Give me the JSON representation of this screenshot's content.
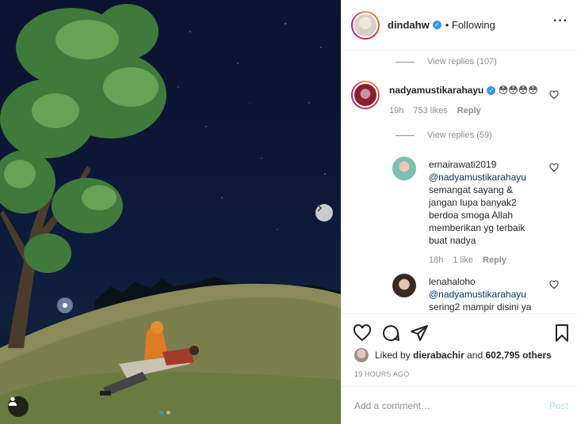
{
  "post": {
    "author": "dindahw",
    "follow_status": "Following",
    "more_icon": "more-options-icon"
  },
  "comments": {
    "view_replies_top": "View replies (107)",
    "main_comment": {
      "username": "nadyamustikarahayu",
      "text": "😳😳😳😳",
      "time": "19h",
      "likes": "753 likes",
      "reply_label": "Reply",
      "view_replies": "View replies (59)"
    },
    "replies": [
      {
        "username": "ernairawati2019",
        "mention": "@nadyamustikarahayu",
        "text": "semangat sayang & jangan lupa banyak2 berdoa smoga Allah memberikan yg terbaik buat nadya",
        "time": "18h",
        "likes": "1 like",
        "reply_label": "Reply"
      },
      {
        "username": "lenahaloho",
        "mention": "@nadyamustikarahayu",
        "text": "sering2 mampir disini ya"
      }
    ]
  },
  "actions": {
    "liked_by_prefix": "Liked by",
    "liked_by_user": "dierabachir",
    "liked_by_and": "and",
    "liked_by_count": "602,795 others",
    "timestamp": "19 HOURS AGO"
  },
  "add_comment": {
    "placeholder": "Add a comment…",
    "post_label": "Post"
  },
  "carousel": {
    "slide_count": 2,
    "current": 1
  },
  "colors": {
    "verified": "#3897f0",
    "mention": "#00376b",
    "muted": "#8e8e8e",
    "post_disabled": "#b2dffc"
  }
}
